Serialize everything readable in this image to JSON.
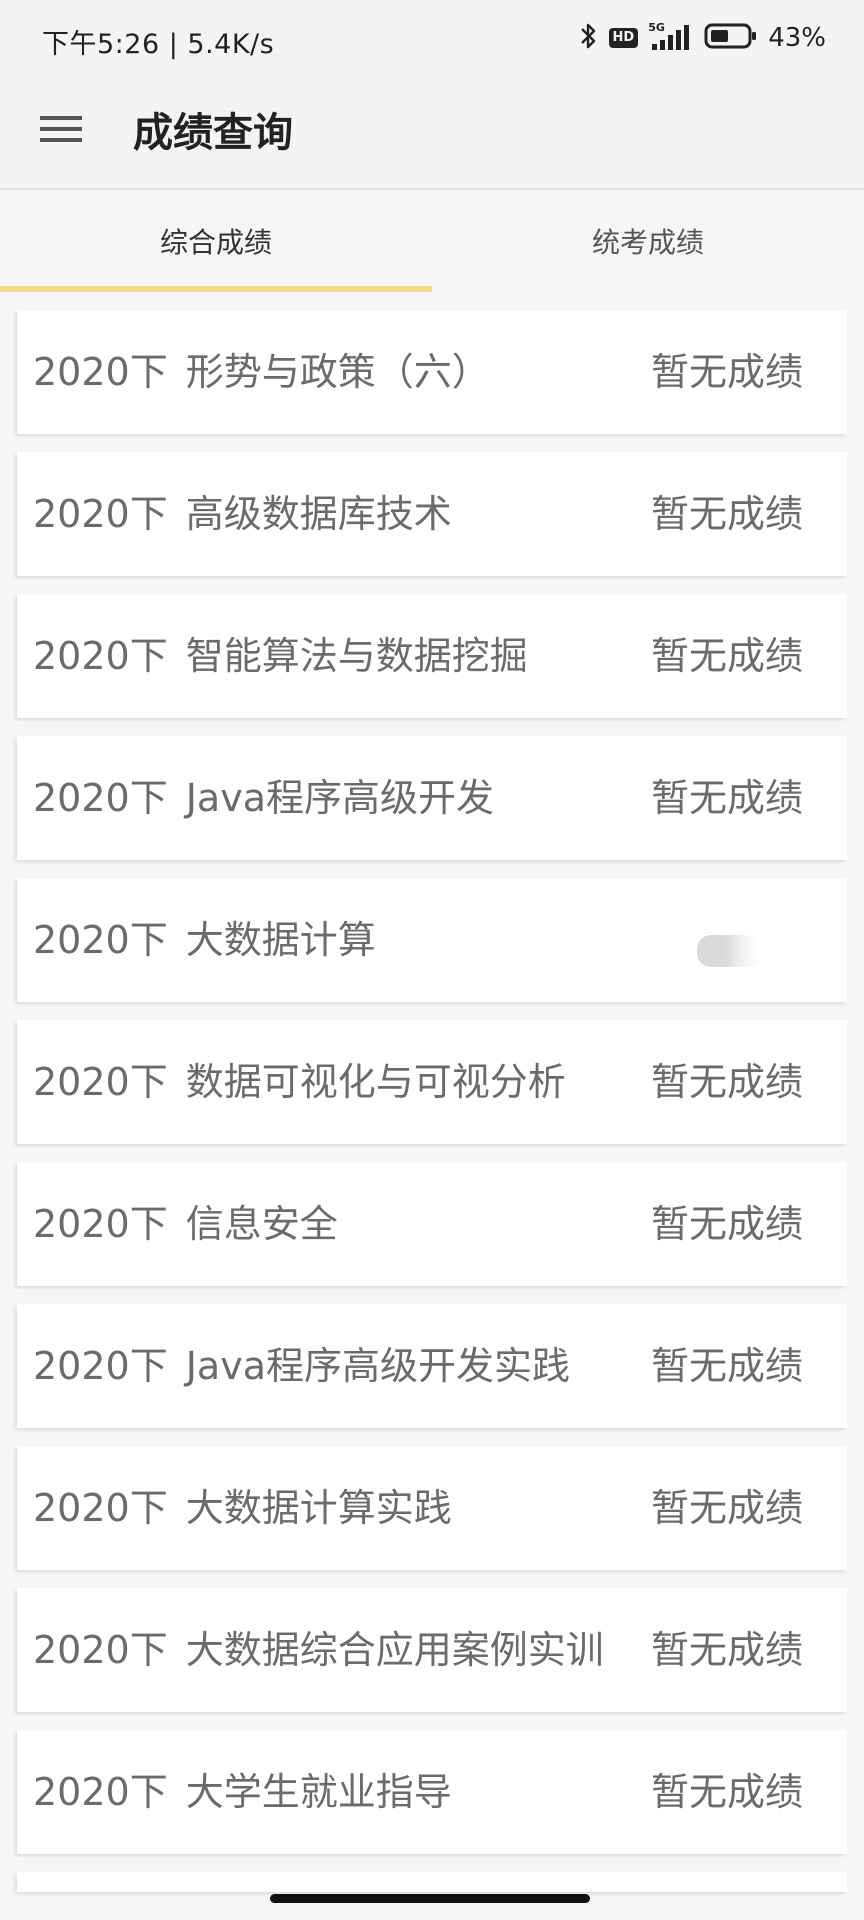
{
  "status_bar": {
    "time_speed": "下午5:26 | 5.4K/s",
    "hd_label": "HD",
    "network_label": "5G",
    "battery_percent": "43%"
  },
  "app_bar": {
    "title": "成绩查询"
  },
  "tabs": [
    {
      "label": "综合成绩",
      "active": true
    },
    {
      "label": "统考成绩",
      "active": false
    }
  ],
  "accent_color": "#f5d78a",
  "courses": [
    {
      "term": "2020下",
      "name": "形势与政策（六）",
      "score": "暂无成绩"
    },
    {
      "term": "2020下",
      "name": "高级数据库技术",
      "score": "暂无成绩"
    },
    {
      "term": "2020下",
      "name": "智能算法与数据挖掘",
      "score": "暂无成绩"
    },
    {
      "term": "2020下",
      "name": "Java程序高级开发",
      "score": "暂无成绩"
    },
    {
      "term": "2020下",
      "name": "大数据计算",
      "score": ""
    },
    {
      "term": "2020下",
      "name": "数据可视化与可视分析",
      "score": "暂无成绩"
    },
    {
      "term": "2020下",
      "name": "信息安全",
      "score": "暂无成绩"
    },
    {
      "term": "2020下",
      "name": "Java程序高级开发实践",
      "score": "暂无成绩"
    },
    {
      "term": "2020下",
      "name": "大数据计算实践",
      "score": "暂无成绩"
    },
    {
      "term": "2020下",
      "name": "大数据综合应用案例实训",
      "score": "暂无成绩"
    },
    {
      "term": "2020下",
      "name": "大学生就业指导",
      "score": "暂无成绩"
    }
  ]
}
